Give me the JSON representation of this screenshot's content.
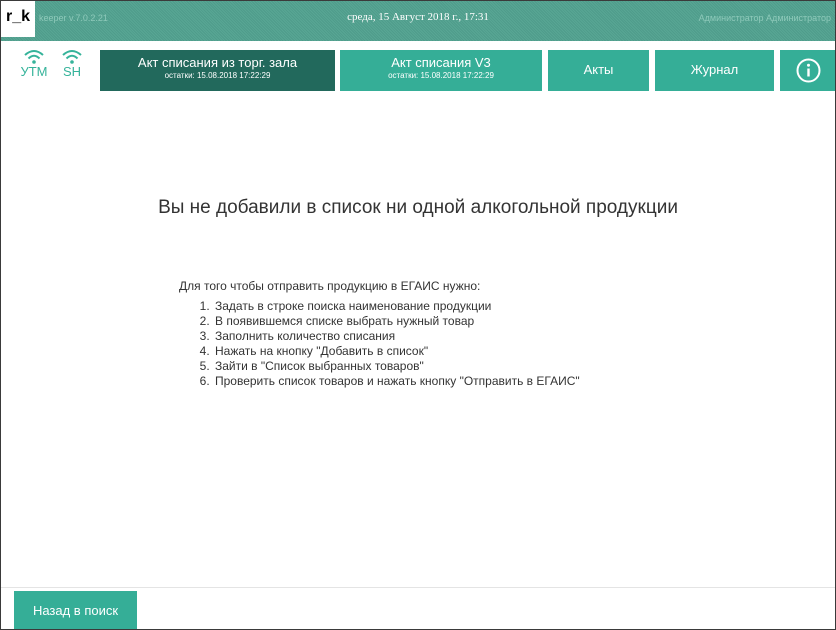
{
  "app": {
    "logo": "r_k",
    "version": "keeper v.7.0.2.21",
    "datetime": "среда, 15 Август 2018 г., 17:31",
    "user": "Администратор Администратор"
  },
  "status": [
    {
      "label": "УТМ",
      "icon": "wifi-icon"
    },
    {
      "label": "SH",
      "icon": "wifi-icon"
    }
  ],
  "nav": {
    "tab1": {
      "title": "Акт списания из торг. зала",
      "subtitle": "остатки: 15.08.2018 17:22:29"
    },
    "tab2": {
      "title": "Акт списания V3",
      "subtitle": "остатки: 15.08.2018 17:22:29"
    },
    "acts": "Акты",
    "journal": "Журнал",
    "info_icon": "info-icon"
  },
  "main": {
    "empty_title": "Вы не добавили в список ни одной алкогольной продукции",
    "intro": "Для того чтобы отправить продукцию в ЕГАИС нужно:",
    "steps": [
      "Задать в строке поиска наименование продукции",
      "В появившемся списке выбрать нужный товар",
      "Заполнить количество списания",
      "Нажать на кнопку \"Добавить в список\"",
      "Зайти в \"Список выбранных товаров\"",
      "Проверить список товаров и нажать кнопку \"Отправить в ЕГАИС\""
    ]
  },
  "footer": {
    "back_label": "Назад в поиск"
  },
  "colors": {
    "accent": "#35ae97",
    "active": "#22695c"
  }
}
